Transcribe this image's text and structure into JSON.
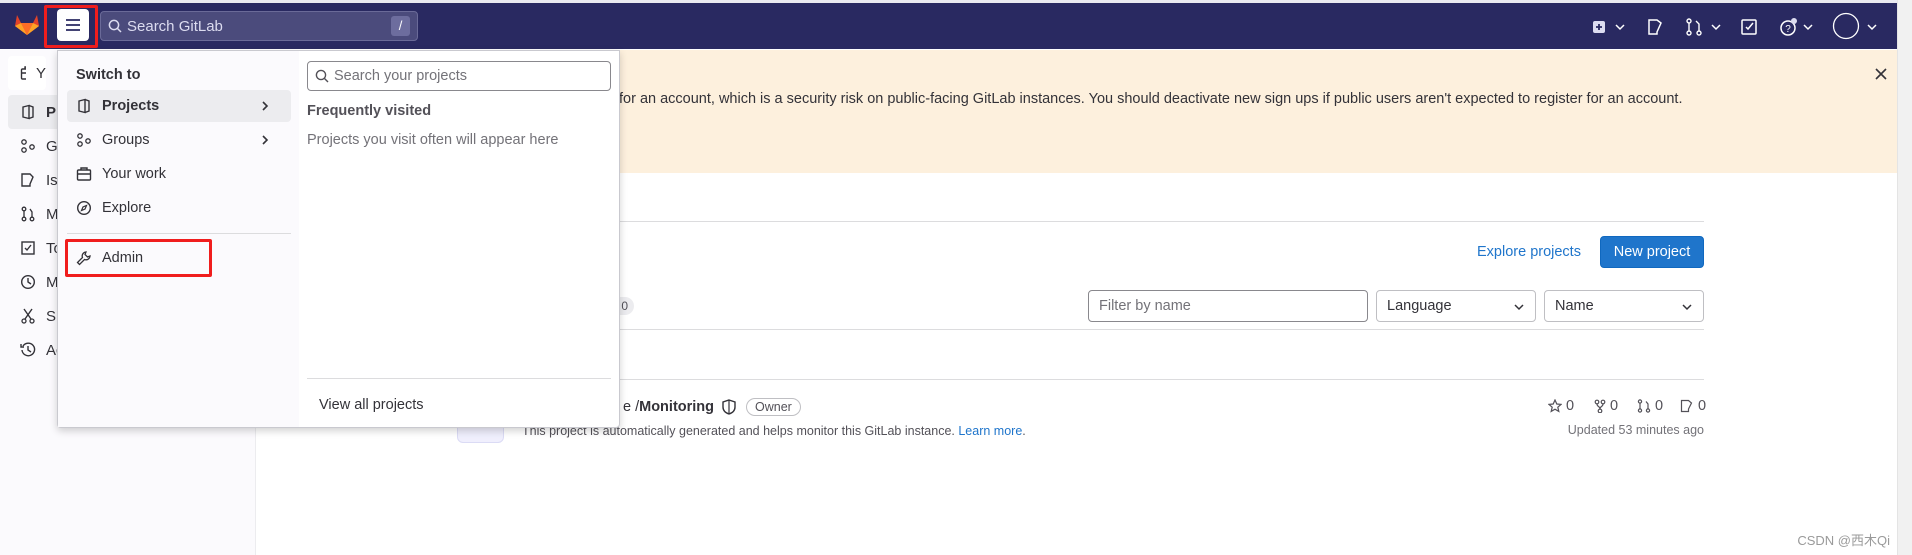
{
  "header": {
    "search_placeholder": "Search GitLab",
    "search_shortcut": "/",
    "icons": [
      "gitlab-logo",
      "hamburger-icon",
      "search-icon",
      "plus-square-icon",
      "issues-icon",
      "merge-request-icon",
      "todo-icon",
      "help-icon",
      "avatar"
    ],
    "bg_color": "#292961"
  },
  "banner": {
    "text": "for an account, which is a security risk on public-facing GitLab instances. You should deactivate new sign ups if public users aren't expected to register for an account.",
    "bg_color": "#fdf0dd"
  },
  "sidebar": {
    "items": [
      {
        "label": "Y",
        "icon": "briefcase-icon"
      },
      {
        "label": "Pr",
        "icon": "project-icon"
      },
      {
        "label": "Gr",
        "icon": "group-icon"
      },
      {
        "label": "Iss",
        "icon": "issues-icon"
      },
      {
        "label": "M",
        "icon": "merge-request-icon"
      },
      {
        "label": "To",
        "icon": "todo-icon"
      },
      {
        "label": "M",
        "icon": "clock-icon"
      },
      {
        "label": "Sn",
        "icon": "snippet-icon"
      },
      {
        "label": "Ac",
        "icon": "history-icon"
      }
    ]
  },
  "dropdown": {
    "heading": "Switch to",
    "items": [
      {
        "label": "Projects",
        "icon": "project-icon",
        "has_submenu": true,
        "active": true
      },
      {
        "label": "Groups",
        "icon": "group-icon",
        "has_submenu": true
      },
      {
        "label": "Your work",
        "icon": "briefcase-icon"
      },
      {
        "label": "Explore",
        "icon": "compass-icon"
      }
    ],
    "admin_label": "Admin",
    "search_placeholder": "Search your projects",
    "frequent_title": "Frequently visited",
    "frequent_empty": "Projects you visit often will appear here",
    "view_all": "View all projects"
  },
  "main": {
    "explore_projects": "Explore projects",
    "new_project": "New project",
    "tab_count_fragment": "0",
    "filter_placeholder": "Filter by name",
    "language_select": "Language",
    "sort_select": "Name",
    "project": {
      "name_fragment": "e / ",
      "name_bold": "Monitoring",
      "role_badge": "Owner",
      "description_fragment": "This project is automatically generated and helps monitor this GitLab instance.",
      "learn_more": "Learn more",
      "stars": "0",
      "forks": "0",
      "merge_requests": "0",
      "issues": "0",
      "updated": "Updated 53 minutes ago"
    },
    "accent_color": "#1f75cb"
  },
  "watermark": "CSDN @西木Qi"
}
